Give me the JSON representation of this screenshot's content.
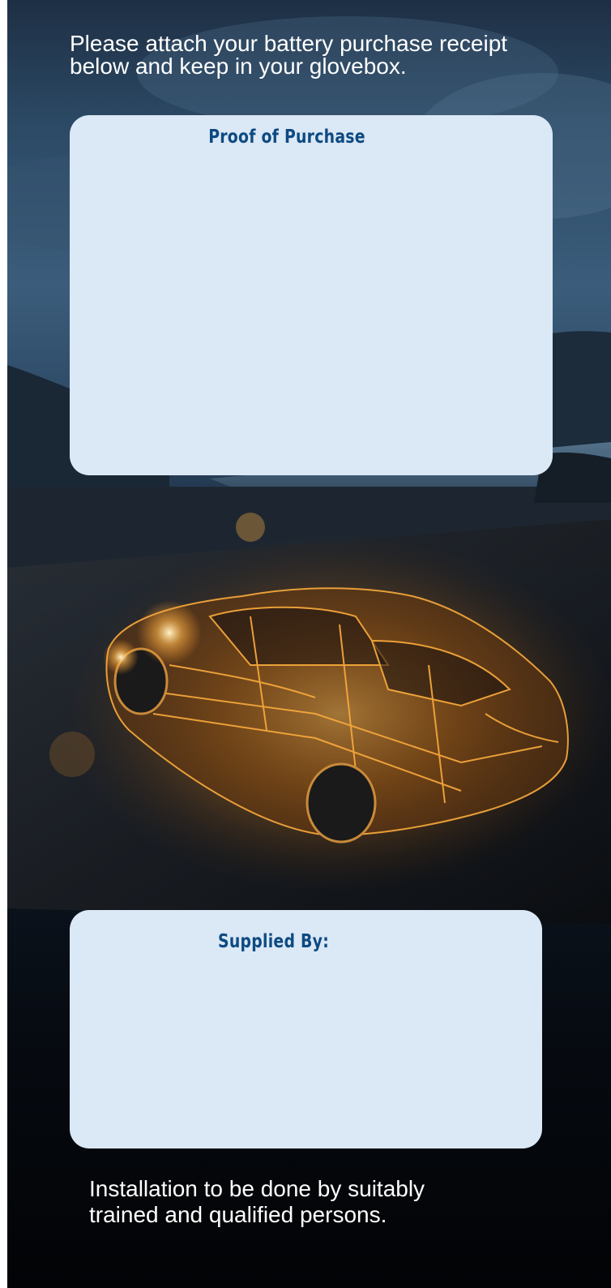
{
  "intro": {
    "line1": "Please attach your battery purchase receipt",
    "line2": "below and keep in your glovebox."
  },
  "proof_card": {
    "title": "Proof of Purchase"
  },
  "supplied_card": {
    "title": "Supplied By:"
  },
  "footer": {
    "line1": "Installation to be done by suitably",
    "line2": "trained and qualified persons."
  },
  "colors": {
    "card_background": "#dbe8f5",
    "card_title": "#0d4a82",
    "text_on_dark": "#ffffff",
    "car_glow": "#f2a53a"
  },
  "background_image": {
    "icon": "glowing-circuit-car-night-road-image"
  }
}
